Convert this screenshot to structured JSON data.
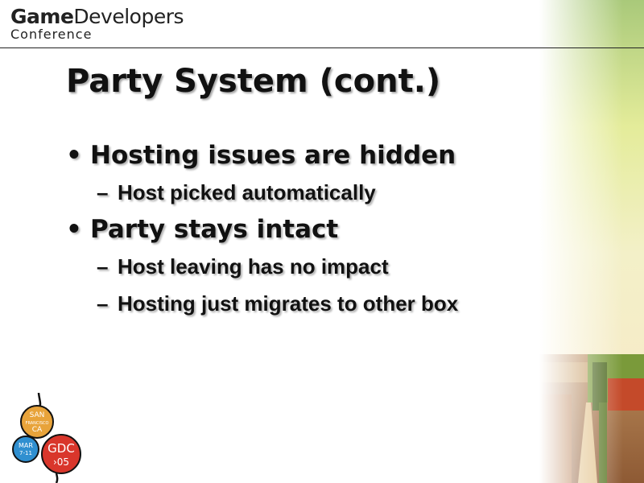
{
  "header": {
    "logo_game": "Game",
    "logo_developers": "Developers",
    "logo_conference": "Conference"
  },
  "slide": {
    "title": "Party System (cont.)",
    "bullets": [
      {
        "text": "Hosting issues are hidden",
        "subs": [
          "Host picked automatically"
        ]
      },
      {
        "text": "Party stays intact",
        "subs": [
          "Host leaving has no impact",
          "Hosting just migrates to other box"
        ]
      }
    ],
    "bullet_marker": "•",
    "sub_marker": "–"
  },
  "badge": {
    "city_line1": "SAN",
    "city_line2": "FRANCISCO",
    "city_line3": "CA",
    "date_line1": "MAR",
    "date_line2": "7-11",
    "event_line1": "GDC",
    "event_line2": "›05"
  },
  "colors": {
    "text": "#111111",
    "badge_orange": "#e8a33a",
    "badge_blue": "#2f8fd0",
    "badge_red": "#d9362b"
  }
}
